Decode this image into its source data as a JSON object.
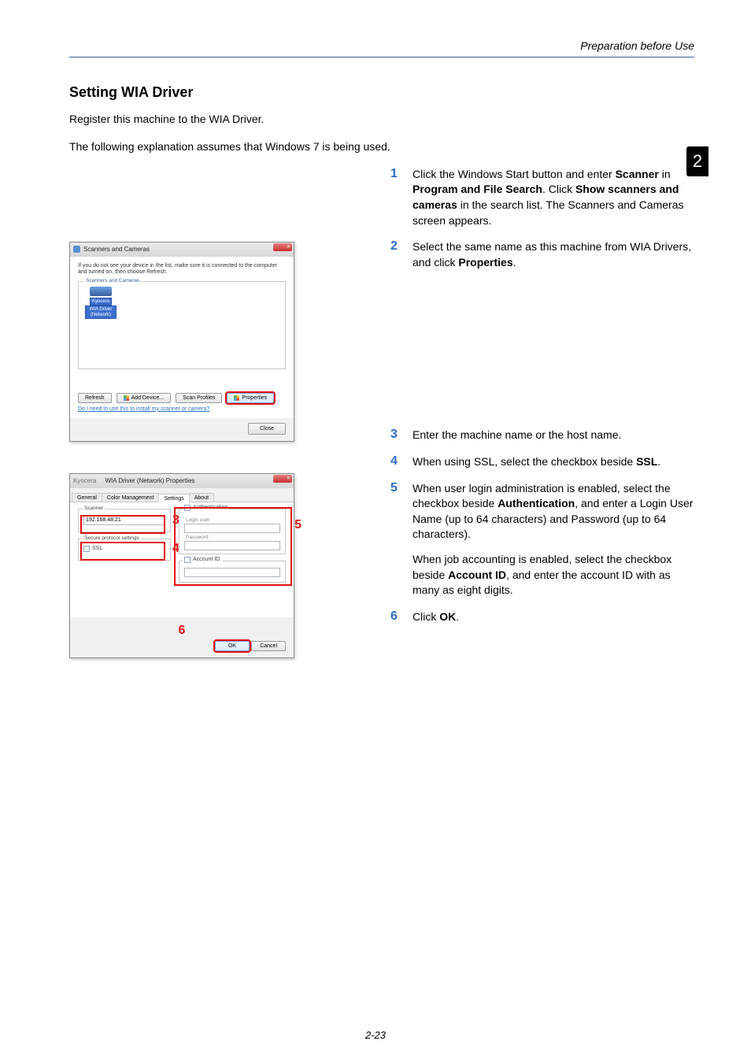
{
  "header": {
    "right": "Preparation before Use"
  },
  "chapter_tab": "2",
  "section_title": "Setting WIA Driver",
  "intro_1": "Register this machine to the WIA Driver.",
  "intro_2": "The following explanation assumes that Windows 7 is being used.",
  "steps": {
    "s1": {
      "pre": "Click the Windows Start button and enter ",
      "b1": "Scanner",
      "mid1": " in ",
      "b2": "Program and File Search",
      "mid2": ". Click ",
      "b3": "Show scanners and cameras",
      "post": " in the search list. The Scanners and Cameras screen appears."
    },
    "s2": {
      "pre": "Select the same name as this machine from WIA Drivers, and click ",
      "b1": "Properties",
      "post": "."
    },
    "s3": "Enter the machine name or the host name.",
    "s4": {
      "pre": "When using SSL, select the checkbox beside ",
      "b1": "SSL",
      "post": "."
    },
    "s5": {
      "pre": "When user login administration is enabled, select the checkbox beside ",
      "b1": "Authentication",
      "post": ", and enter a Login User Name (up to 64 characters) and Password (up to 64 characters).",
      "sub_pre": "When job accounting is enabled, select the checkbox beside ",
      "sub_b1": "Account ID",
      "sub_post": ", and enter the account ID with as many as eight digits."
    },
    "s6": {
      "pre": "Click ",
      "b1": "OK",
      "post": "."
    }
  },
  "dialog1": {
    "title": "Scanners and Cameras",
    "message": "If you do not see your device in the list, make sure it is connected to the computer and turned on, then choose Refresh.",
    "fieldset_legend": "Scanners and Cameras",
    "device_line1": "Kyocera",
    "device_line2": "WIA Driver (Network)",
    "btn_refresh": "Refresh",
    "btn_add": "Add Device...",
    "btn_scan": "Scan Profiles",
    "btn_properties": "Properties",
    "link": "Do I need to use this to install my scanner or camera?",
    "btn_close": "Close"
  },
  "dialog2": {
    "title": "WIA Driver (Network) Properties",
    "tabs": [
      "General",
      "Color Management",
      "Settings",
      "About"
    ],
    "active_tab": "Settings",
    "scanner_legend": "Scanner",
    "scanner_value": "192.168.48.21",
    "secure_legend": "Secure protocol settings",
    "chk_ssl": "SSL",
    "auth_legend": "Authentication",
    "field_login": "Login user",
    "field_password": "Password:",
    "acct_legend": "Account ID:",
    "btn_ok": "OK",
    "btn_cancel": "Cancel"
  },
  "callouts": {
    "c3": "3",
    "c4": "4",
    "c5": "5",
    "c6": "6"
  },
  "page_num": "2-23"
}
